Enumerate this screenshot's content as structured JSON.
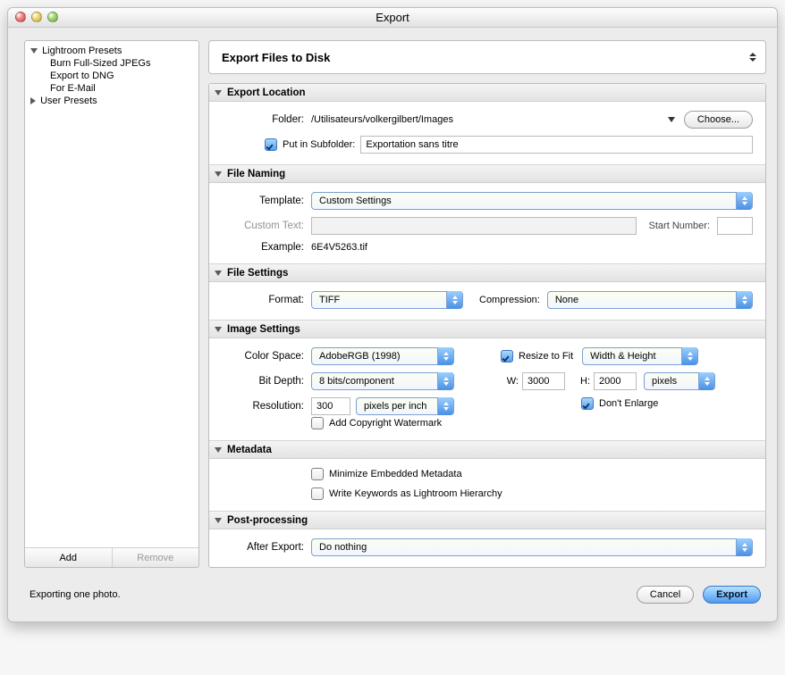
{
  "window": {
    "title": "Export"
  },
  "sidebar": {
    "groups": [
      {
        "label": "Lightroom Presets",
        "open": true,
        "items": [
          "Burn Full-Sized JPEGs",
          "Export to DNG",
          "For E-Mail"
        ]
      },
      {
        "label": "User Presets",
        "open": false,
        "items": []
      }
    ],
    "add": "Add",
    "remove": "Remove"
  },
  "destination": {
    "label": "Export Files to Disk"
  },
  "panels": {
    "export_location": {
      "title": "Export Location",
      "folder_label": "Folder:",
      "folder_path": "/Utilisateurs/volkergilbert/Images",
      "choose": "Choose...",
      "subfolder_checked": true,
      "subfolder_label": "Put in Subfolder:",
      "subfolder_value": "Exportation sans titre"
    },
    "file_naming": {
      "title": "File Naming",
      "template_label": "Template:",
      "template_value": "Custom Settings",
      "custom_text_label": "Custom Text:",
      "start_number_label": "Start Number:",
      "example_label": "Example:",
      "example_value": "6E4V5263.tif"
    },
    "file_settings": {
      "title": "File Settings",
      "format_label": "Format:",
      "format_value": "TIFF",
      "compression_label": "Compression:",
      "compression_value": "None"
    },
    "image_settings": {
      "title": "Image Settings",
      "color_space_label": "Color Space:",
      "color_space_value": "AdobeRGB (1998)",
      "bit_depth_label": "Bit Depth:",
      "bit_depth_value": "8 bits/component",
      "resolution_label": "Resolution:",
      "resolution_value": "300",
      "resolution_unit": "pixels per inch",
      "resize_checked": true,
      "resize_label": "Resize to Fit",
      "resize_mode": "Width & Height",
      "w_label": "W:",
      "w_value": "3000",
      "h_label": "H:",
      "h_value": "2000",
      "size_unit": "pixels",
      "dont_enlarge_checked": true,
      "dont_enlarge_label": "Don't Enlarge",
      "watermark_checked": false,
      "watermark_label": "Add Copyright Watermark"
    },
    "metadata": {
      "title": "Metadata",
      "min_label": "Minimize Embedded Metadata",
      "min_checked": false,
      "hierarchy_label": "Write Keywords as Lightroom Hierarchy",
      "hierarchy_checked": false
    },
    "post": {
      "title": "Post-processing",
      "after_label": "After Export:",
      "after_value": "Do nothing"
    }
  },
  "footer": {
    "status": "Exporting one photo.",
    "cancel": "Cancel",
    "export": "Export"
  }
}
